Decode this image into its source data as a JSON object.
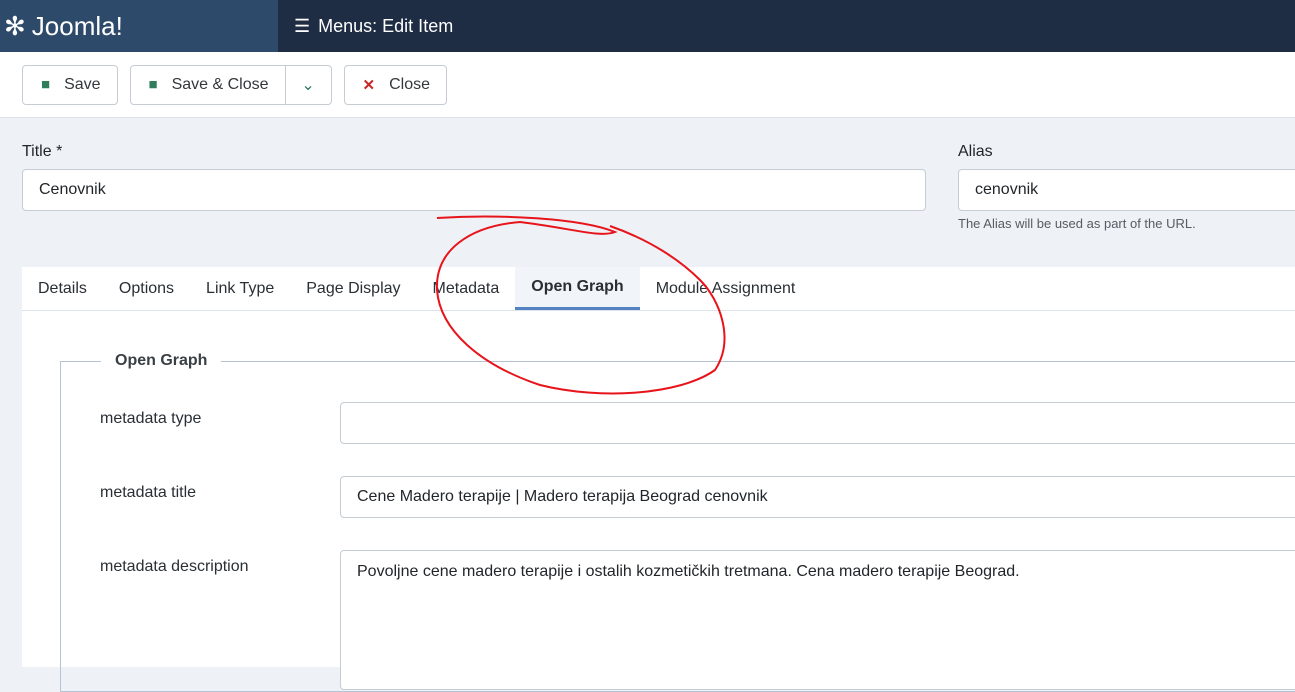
{
  "header": {
    "brand": "Joomla!",
    "title": "Menus: Edit Item"
  },
  "toolbar": {
    "save": "Save",
    "save_close": "Save & Close",
    "close": "Close"
  },
  "form": {
    "title_label": "Title *",
    "title_value": "Cenovnik",
    "alias_label": "Alias",
    "alias_value": "cenovnik",
    "alias_hint": "The Alias will be used as part of the URL."
  },
  "tabs": [
    "Details",
    "Options",
    "Link Type",
    "Page Display",
    "Metadata",
    "Open Graph",
    "Module Assignment"
  ],
  "fieldset": {
    "legend": "Open Graph",
    "fields": [
      {
        "label": "metadata type",
        "value": ""
      },
      {
        "label": "metadata title",
        "value": "Cene Madero terapije | Madero terapija Beograd cenovnik"
      },
      {
        "label": "metadata description",
        "value": "Povoljne cene madero terapije i ostalih kozmetičkih tretmana. Cena madero terapije Beograd."
      }
    ]
  },
  "colors": {
    "annotation": "#e8141b",
    "accent": "#5381c2"
  }
}
